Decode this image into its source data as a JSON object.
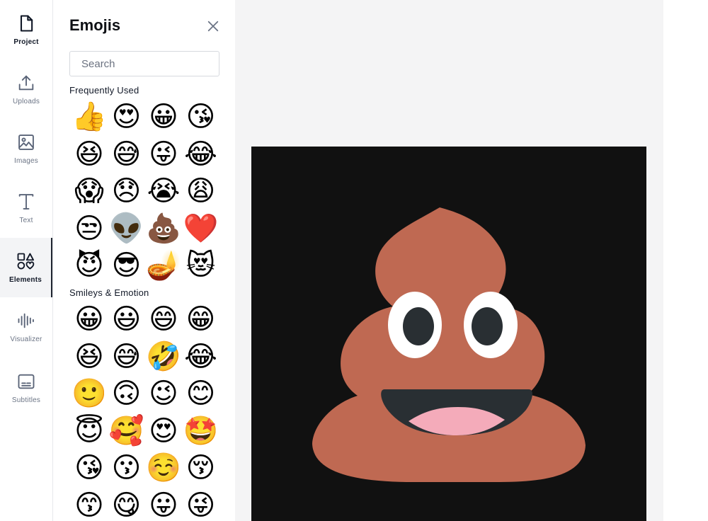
{
  "sidebar": {
    "items": [
      {
        "label": "Project",
        "icon": "file-icon"
      },
      {
        "label": "Uploads",
        "icon": "upload-icon"
      },
      {
        "label": "Images",
        "icon": "image-icon"
      },
      {
        "label": "Text",
        "icon": "text-icon"
      },
      {
        "label": "Elements",
        "icon": "shapes-icon",
        "active": true
      },
      {
        "label": "Visualizer",
        "icon": "waveform-icon"
      },
      {
        "label": "Subtitles",
        "icon": "subtitles-icon"
      }
    ]
  },
  "panel": {
    "title": "Emojis",
    "search_placeholder": "Search",
    "sections": [
      {
        "title": "Frequently Used",
        "emojis": [
          "👍",
          "😍",
          "😀",
          "😘",
          "😆",
          "😅",
          "😜",
          "😂",
          "😱",
          "😞",
          "😭",
          "😩",
          "😒",
          "👽",
          "💩",
          "❤️",
          "😈",
          "😎",
          "🪔",
          "😻"
        ]
      },
      {
        "title": "Smileys & Emotion",
        "emojis": [
          "😀",
          "😃",
          "😄",
          "😁",
          "😆",
          "😅",
          "🤣",
          "😂",
          "🙂",
          "🙃",
          "😉",
          "😊",
          "😇",
          "🥰",
          "😍",
          "🤩",
          "😘",
          "😗",
          "☺️",
          "😚",
          "😙",
          "😋",
          "😛",
          "😜"
        ]
      }
    ]
  },
  "canvas": {
    "background_color": "#111111",
    "element": "pile-of-poo-emoji",
    "poo_color": "#bf6952"
  }
}
